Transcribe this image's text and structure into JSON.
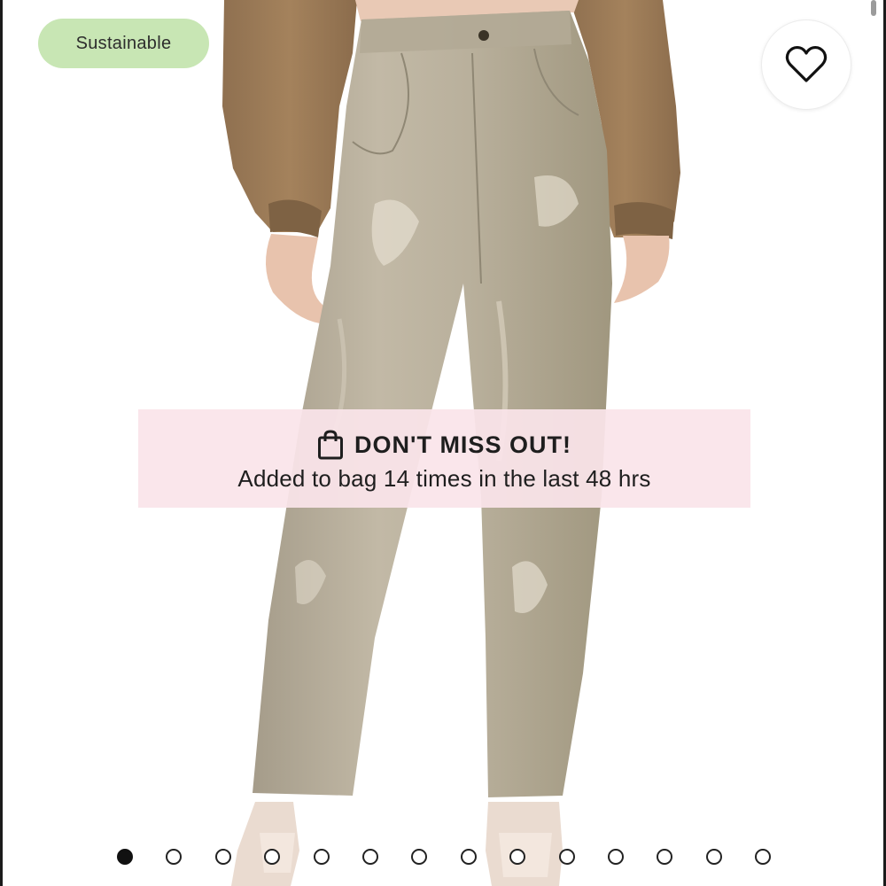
{
  "badge": {
    "label": "Sustainable",
    "color": "#c8e6b4"
  },
  "wishlist": {
    "icon": "heart-icon"
  },
  "banner": {
    "icon": "shopping-bag-icon",
    "title": "DON'T MISS OUT!",
    "subtitle": "Added to bag 14 times in the last 48 hrs",
    "background": "#fae4ea"
  },
  "carousel": {
    "total": 14,
    "active_index": 0
  }
}
